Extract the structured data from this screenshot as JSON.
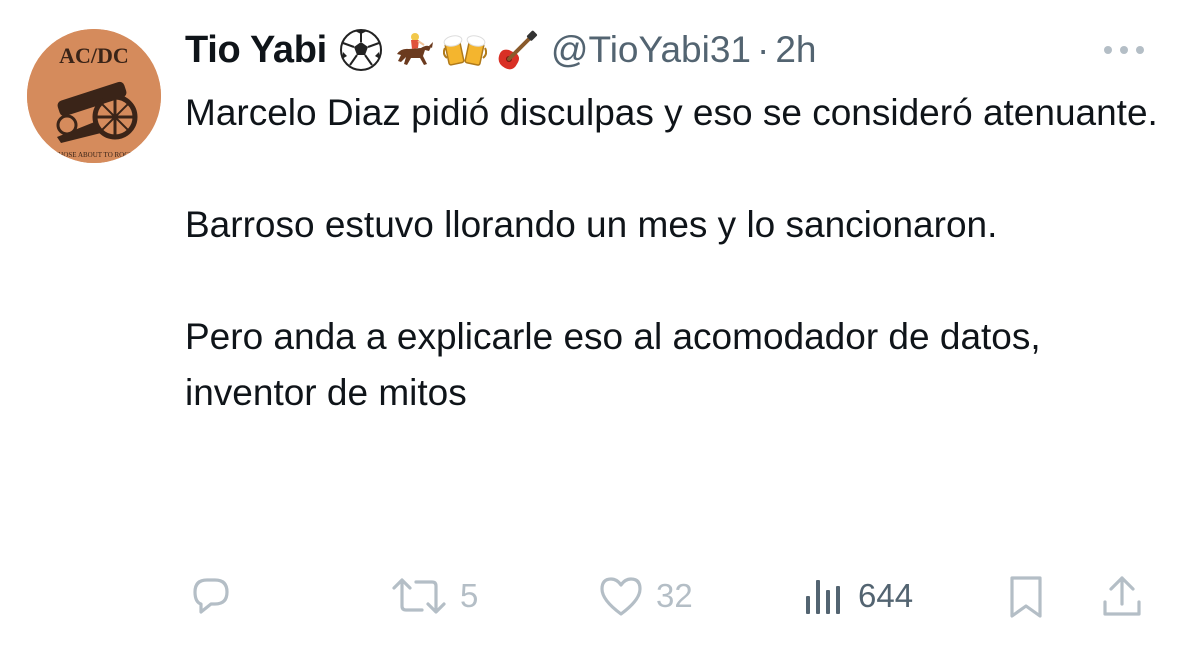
{
  "author": {
    "display_name": "Tio Yabi",
    "handle": "@TioYabi31",
    "separator": "·",
    "timestamp": "2h",
    "avatar": {
      "description_icon": "acdc-cannon-avatar",
      "logo_text": "AC/DC",
      "tagline_text": "THOSE ABOUT TO ROCK"
    },
    "emojis": [
      "soccer-ball-icon",
      "horse-racing-icon",
      "beer-mugs-icon",
      "guitar-icon"
    ]
  },
  "tweet": {
    "paragraphs": [
      "Marcelo Diaz pidió disculpas y eso se consideró atenuante.",
      "Barroso estuvo llorando un mes y lo sancionaron.",
      "Pero anda a explicarle eso al acomodador de datos, inventor de mitos"
    ]
  },
  "actions": {
    "reply": {
      "icon": "reply-icon",
      "count": ""
    },
    "retweet": {
      "icon": "retweet-icon",
      "count": "5"
    },
    "like": {
      "icon": "heart-icon",
      "count": "32"
    },
    "views": {
      "icon": "views-bar-chart-icon",
      "count": "644"
    },
    "bookmark": {
      "icon": "bookmark-icon"
    },
    "share": {
      "icon": "share-icon"
    }
  },
  "colors": {
    "text": "#0f1419",
    "secondary": "#536471",
    "faded_action": "#b4bec6",
    "background": "#ffffff",
    "avatar_bg": "#d58b5c"
  }
}
